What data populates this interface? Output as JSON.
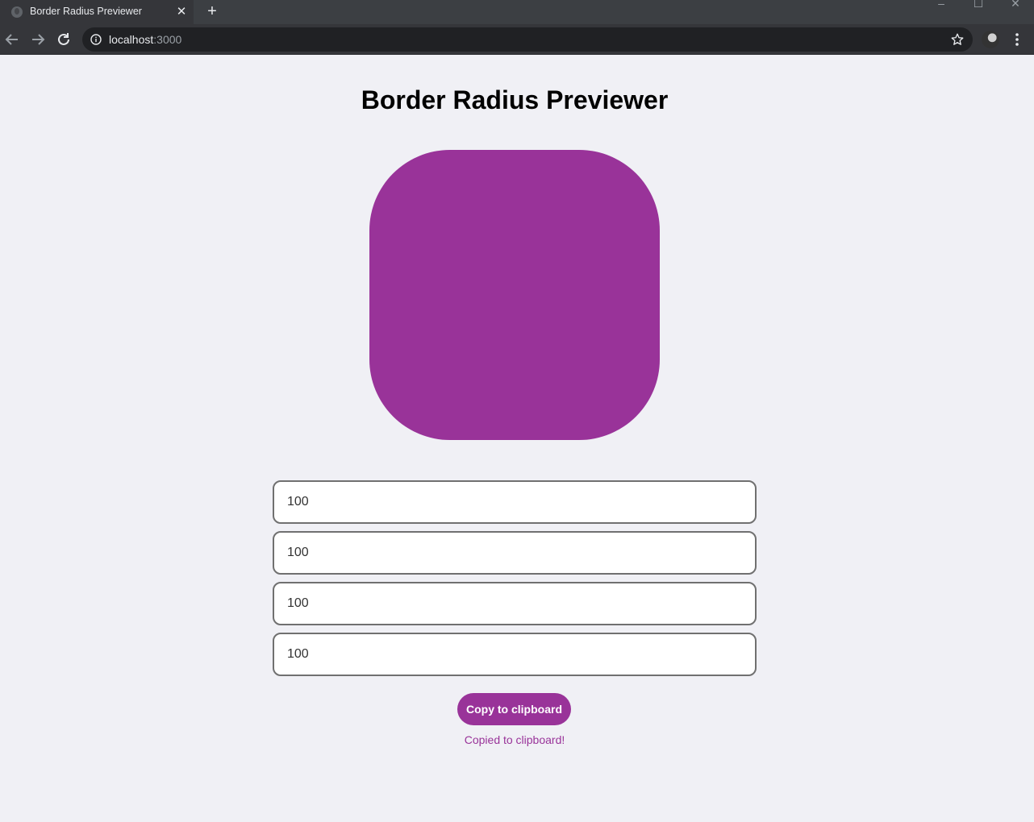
{
  "browser": {
    "tab_title": "Border Radius Previewer",
    "tab_close_glyph": "✕",
    "new_tab_glyph": "+",
    "url_host": "localhost",
    "url_port": ":3000",
    "window_controls": {
      "minimize": "–",
      "maximize": "☐",
      "close": "✕"
    }
  },
  "page": {
    "title": "Border Radius Previewer",
    "preview_color": "#993399",
    "radius_fields": [
      {
        "value": "100"
      },
      {
        "value": "100"
      },
      {
        "value": "100"
      },
      {
        "value": "100"
      }
    ],
    "copy_button_label": "Copy to clipboard",
    "status_message": "Copied to clipboard!"
  },
  "colors": {
    "accent": "#993399",
    "background": "#f0f0f5"
  }
}
